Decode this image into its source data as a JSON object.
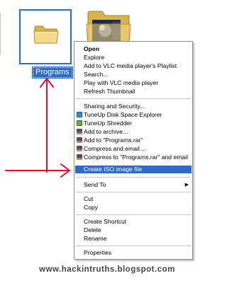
{
  "folder": {
    "label": "Programs"
  },
  "menu": {
    "items": [
      {
        "label": "Open",
        "bold": true
      },
      {
        "label": "Explore"
      },
      {
        "label": "Add to VLC media player's Playlist"
      },
      {
        "label": "Search..."
      },
      {
        "label": "Play with VLC media player"
      },
      {
        "label": "Refresh Thumbnail"
      },
      {
        "label": "Sharing and Security..."
      },
      {
        "label": "TuneUp Disk Space Explorer",
        "icon": "tuneup-icon"
      },
      {
        "label": "TuneUp Shredder",
        "icon": "shredder-icon"
      },
      {
        "label": "Add to archive...",
        "icon": "winrar-icon"
      },
      {
        "label": "Add to \"Programs.rar\"",
        "icon": "winrar-icon"
      },
      {
        "label": "Compress and email...",
        "icon": "winrar-icon"
      },
      {
        "label": "Compress to \"Programs.rar\" and email",
        "icon": "winrar-icon"
      },
      {
        "label": "Create ISO image file",
        "selected": true
      },
      {
        "label": "Send To",
        "submenu": true
      },
      {
        "label": "Cut"
      },
      {
        "label": "Copy"
      },
      {
        "label": "Create Shortcut"
      },
      {
        "label": "Delete"
      },
      {
        "label": "Rename"
      },
      {
        "label": "Properties"
      }
    ]
  },
  "watermark": "www.hackintruths.blogspot.com",
  "colors": {
    "selection": "#316ac5",
    "arrow": "#e0102a",
    "folder": "#f3d377"
  }
}
